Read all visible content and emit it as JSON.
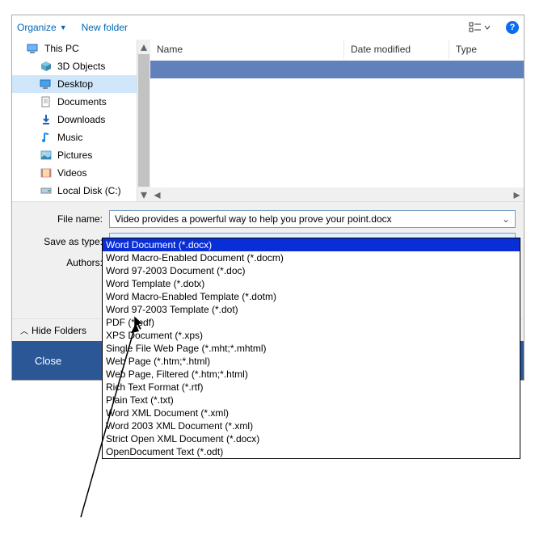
{
  "toolbar": {
    "organize": "Organize",
    "newfolder": "New folder"
  },
  "nav": {
    "thispc": "This PC",
    "objects3d": "3D Objects",
    "desktop": "Desktop",
    "documents": "Documents",
    "downloads": "Downloads",
    "music": "Music",
    "pictures": "Pictures",
    "videos": "Videos",
    "localdisk": "Local Disk (C:)"
  },
  "columns": {
    "name": "Name",
    "date": "Date modified",
    "type": "Type"
  },
  "form": {
    "filename_label": "File name:",
    "filename_value": "Video provides a powerful way to help you prove your point.docx",
    "saveas_label": "Save as type:",
    "saveas_value": "Word Document (*.docx)",
    "authors_label": "Authors:"
  },
  "dropdown": {
    "items": [
      "Word Document (*.docx)",
      "Word Macro-Enabled Document (*.docm)",
      "Word 97-2003 Document (*.doc)",
      "Word Template (*.dotx)",
      "Word Macro-Enabled Template (*.dotm)",
      "Word 97-2003 Template (*.dot)",
      "PDF (*.pdf)",
      "XPS Document (*.xps)",
      "Single File Web Page (*.mht;*.mhtml)",
      "Web Page (*.htm;*.html)",
      "Web Page, Filtered (*.htm;*.html)",
      "Rich Text Format (*.rtf)",
      "Plain Text (*.txt)",
      "Word XML Document (*.xml)",
      "Word 2003 XML Document (*.xml)",
      "Strict Open XML Document (*.docx)",
      "OpenDocument Text (*.odt)"
    ]
  },
  "bottom": {
    "hidefolders": "Hide Folders"
  },
  "close": {
    "label": "Close"
  }
}
